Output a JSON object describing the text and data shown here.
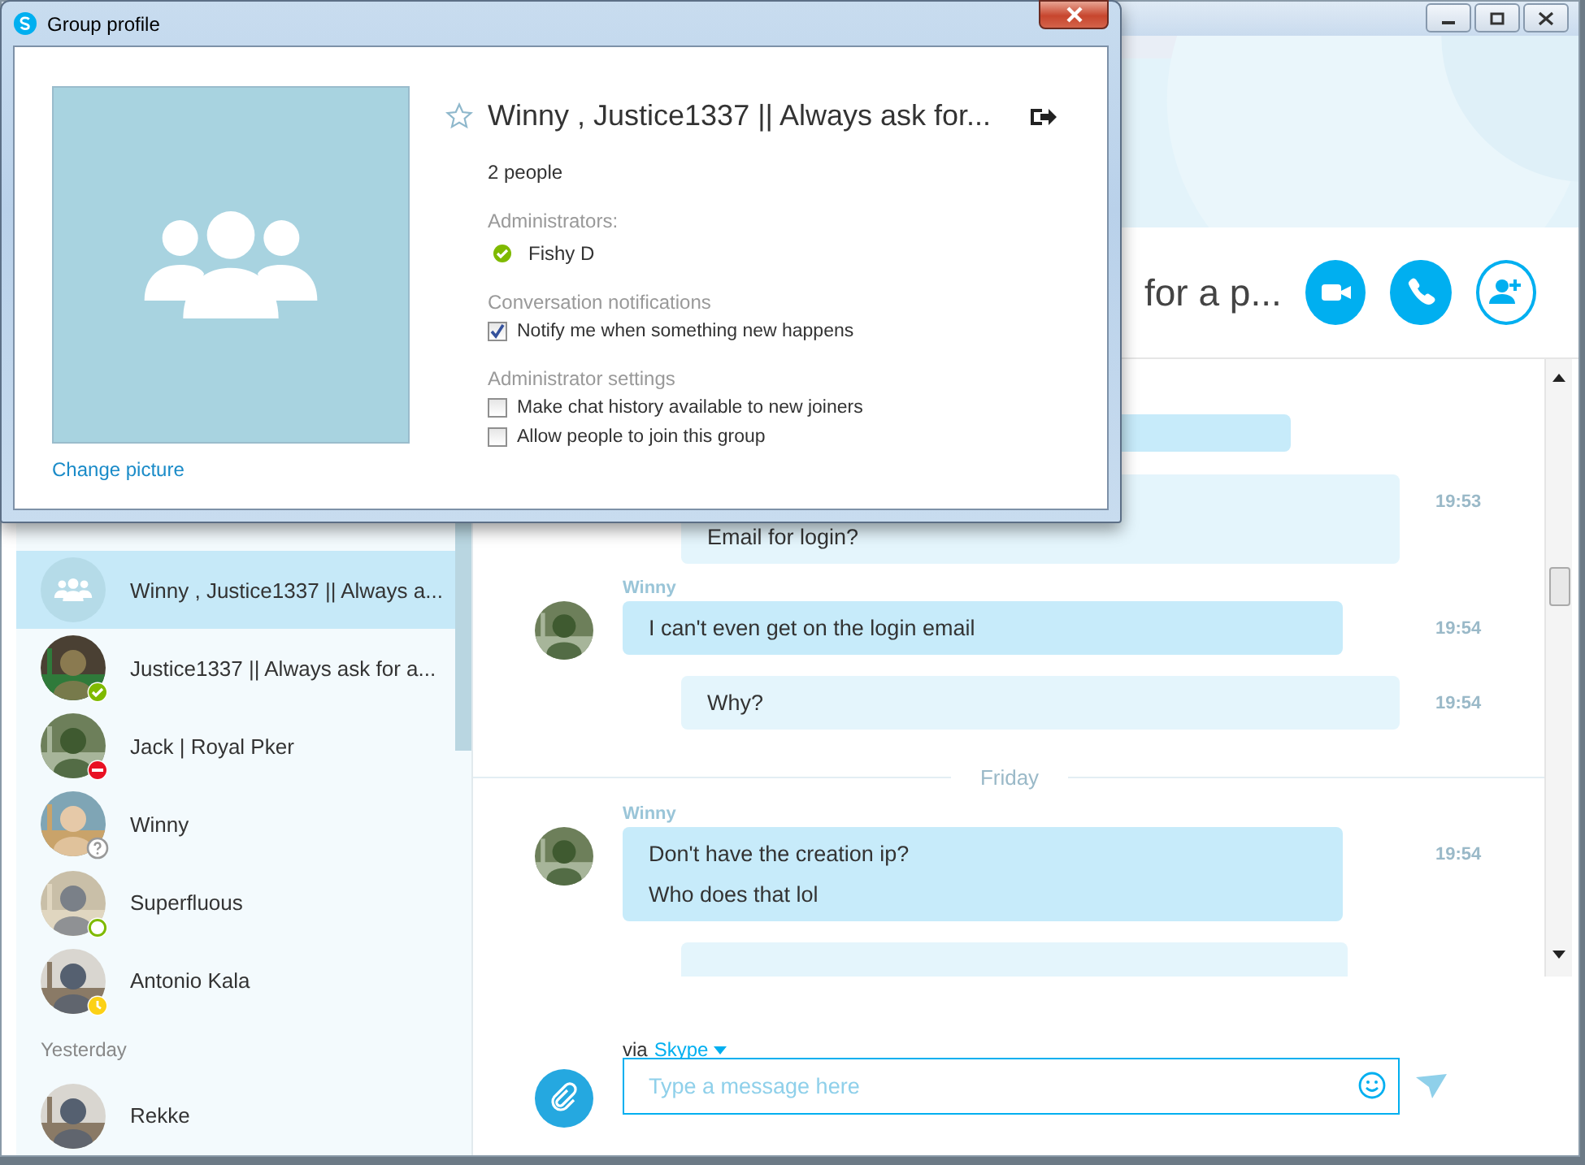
{
  "conversation": {
    "title_visible": "for a p..."
  },
  "sidebar": {
    "items": [
      {
        "name": "Winny , Justice1337 || Always a...",
        "kind": "group",
        "selected": true
      },
      {
        "name": "Justice1337 || Always ask for a...",
        "status": {
          "kind": "online",
          "color": "#7fba00"
        },
        "selected": false
      },
      {
        "name": "Jack | Royal Pker",
        "status": {
          "kind": "busy",
          "color": "#e81123"
        },
        "selected": false
      },
      {
        "name": "Winny",
        "status": {
          "kind": "unknown",
          "color": "#999999"
        },
        "selected": false
      },
      {
        "name": "Superfluous",
        "status": {
          "kind": "offline",
          "color": "#7fba00"
        },
        "selected": false
      },
      {
        "name": "Antonio Kala",
        "status": {
          "kind": "away",
          "color": "#fcd116"
        },
        "selected": false
      }
    ],
    "section": "Yesterday",
    "more": [
      {
        "name": "Rekke",
        "selected": false
      }
    ]
  },
  "messages": [
    {
      "kind": "outgoing",
      "lines": [
        "Email for login?"
      ],
      "time": "19:53"
    },
    {
      "kind": "incoming",
      "sender": "Winny",
      "lines": [
        "I can't even get on the login email"
      ],
      "time": "19:54"
    },
    {
      "kind": "outgoing",
      "lines": [
        "Why?"
      ],
      "time": "19:54"
    },
    {
      "kind": "divider",
      "label": "Friday"
    },
    {
      "kind": "incoming",
      "sender": "Winny",
      "lines": [
        "Don't have the creation ip?",
        "Who does that lol"
      ],
      "time": "19:54"
    }
  ],
  "composer": {
    "via": "via",
    "service": "Skype",
    "placeholder": "Type a message here"
  },
  "dialog": {
    "title": "Group profile",
    "change_picture": "Change picture",
    "group_name": "Winny , Justice1337 || Always ask for...",
    "favorite": false,
    "people": "2 people",
    "admins_label": "Administrators:",
    "admins": [
      {
        "name": "Fishy D",
        "status": {
          "kind": "online",
          "color": "#7fba00"
        }
      }
    ],
    "notifications_label": "Conversation notifications",
    "notifications": [
      {
        "label": "Notify me when something new happens",
        "checked": true
      }
    ],
    "admin_settings_label": "Administrator settings",
    "admin_settings": [
      {
        "label": "Make chat history available to new joiners",
        "checked": false
      },
      {
        "label": "Allow people to join this group",
        "checked": false
      }
    ]
  }
}
